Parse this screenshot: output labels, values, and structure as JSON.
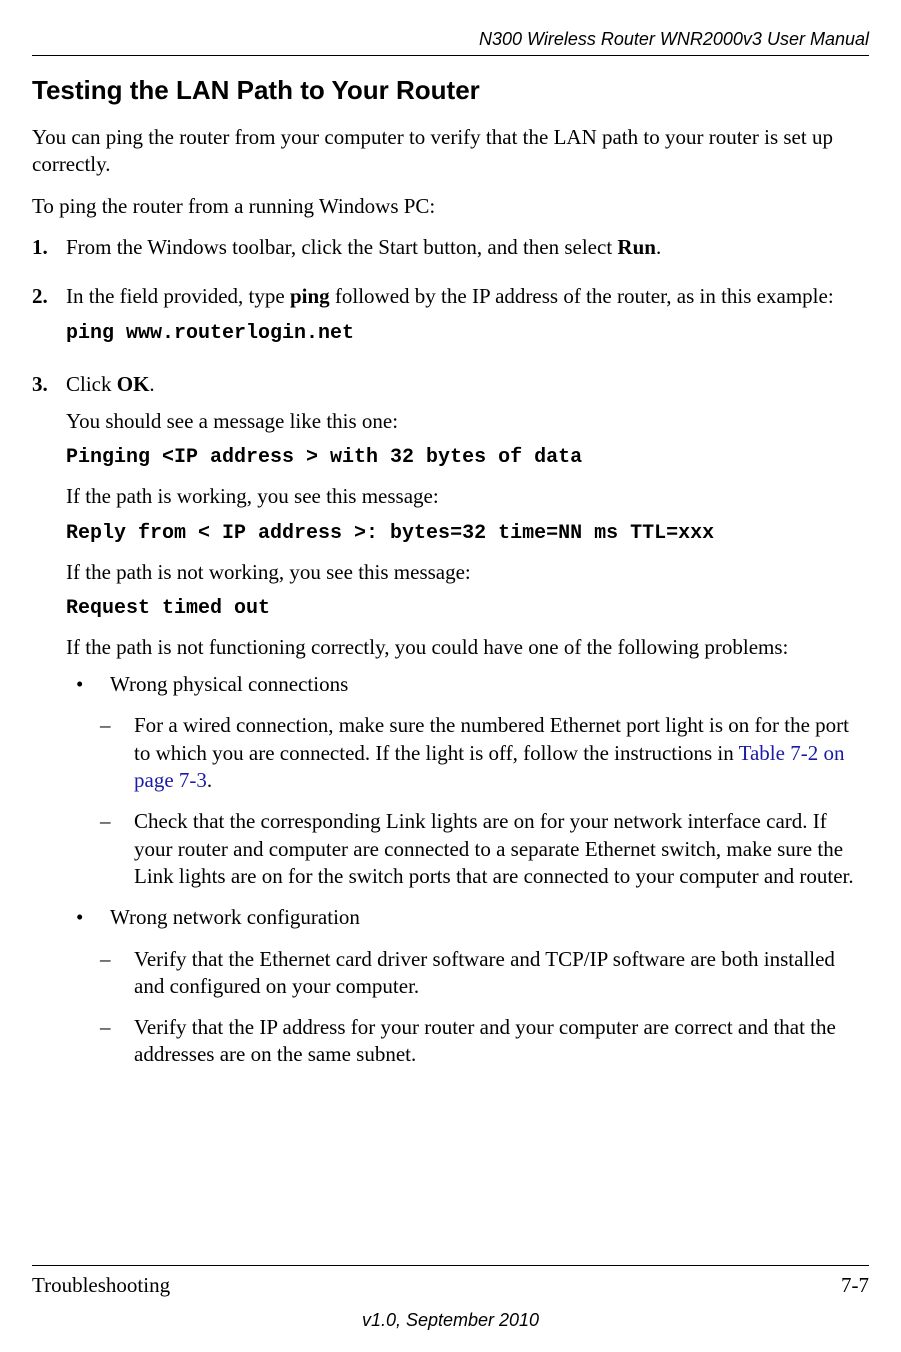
{
  "header": {
    "doc_title": "N300 Wireless Router WNR2000v3 User Manual"
  },
  "section": {
    "title": "Testing the LAN Path to Your Router",
    "intro": "You can ping the router from your computer to verify that the LAN path to your router is set up correctly.",
    "preamble": "To ping the router from a running Windows PC:"
  },
  "steps": {
    "s1": {
      "num": "1.",
      "text_a": "From the Windows toolbar, click the Start button, and then select ",
      "bold_a": "Run",
      "text_b": "."
    },
    "s2": {
      "num": "2.",
      "text_a": "In the field provided, type ",
      "bold_a": "ping",
      "text_b": " followed by the IP address of the router, as in this example:",
      "code": "ping www.routerlogin.net"
    },
    "s3": {
      "num": "3.",
      "text_a": "Click ",
      "bold_a": "OK",
      "text_b": ".",
      "p1": "You should see a message like this one:",
      "code1": "Pinging <IP address > with 32 bytes of data",
      "p2": "If the path is working, you see this message:",
      "code2": "Reply from < IP address >: bytes=32 time=NN ms TTL=xxx",
      "p3": "If the path is not working, you see this message:",
      "code3": "Request timed out",
      "p4": "If the path is not functioning correctly, you could have one of the following problems:"
    }
  },
  "bullets": {
    "b1": {
      "mark": "•",
      "text": "Wrong physical connections",
      "sub1": {
        "mark": "–",
        "text_a": "For a wired connection, make sure the numbered Ethernet port light is on for the port to which you are connected. If the light is off, follow the instructions in ",
        "link": "Table 7-2 on page 7-3",
        "text_b": "."
      },
      "sub2": {
        "mark": "–",
        "text": "Check that the corresponding Link lights are on for your network interface card. If your router and computer are connected to a separate Ethernet switch, make sure the Link lights are on for the switch ports that are connected to your computer and router."
      }
    },
    "b2": {
      "mark": "•",
      "text": "Wrong network configuration",
      "sub1": {
        "mark": "–",
        "text": "Verify that the Ethernet card driver software and TCP/IP software are both installed and configured on your computer."
      },
      "sub2": {
        "mark": "–",
        "text": "Verify that the IP address for your router and your computer are correct and that the addresses are on the same subnet."
      }
    }
  },
  "footer": {
    "section": "Troubleshooting",
    "page": "7-7",
    "version": "v1.0, September 2010"
  }
}
